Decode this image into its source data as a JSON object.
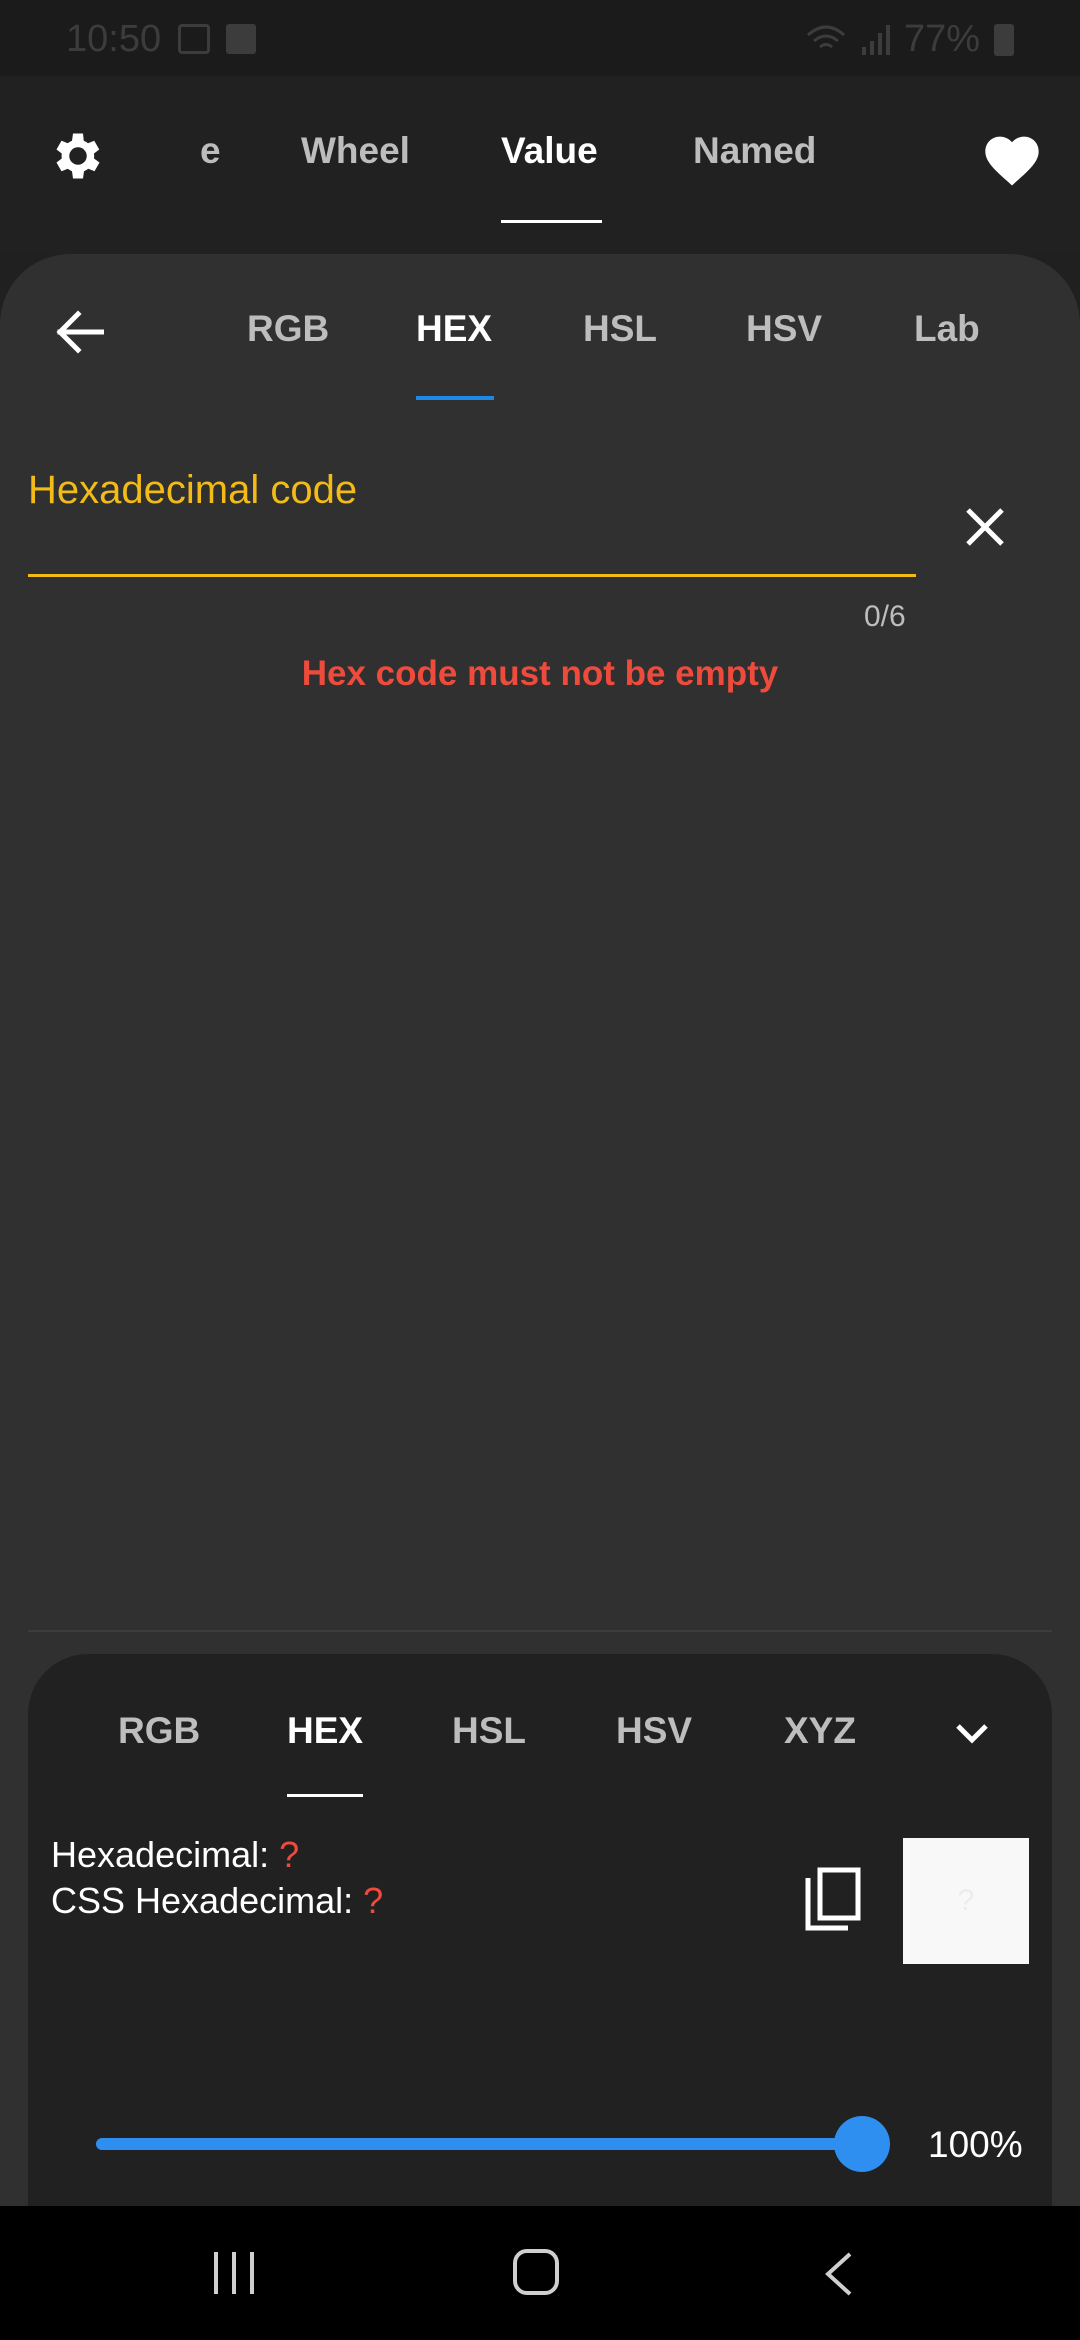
{
  "status_bar": {
    "time": "10:50",
    "battery": "77%"
  },
  "top_tabs": {
    "partial": "e",
    "wheel": "Wheel",
    "value": "Value",
    "named": "Named"
  },
  "sub_tabs": {
    "rgb": "RGB",
    "hex": "HEX",
    "hsl": "HSL",
    "hsv": "HSV",
    "lab": "Lab"
  },
  "hex_input": {
    "label": "Hexadecimal code",
    "value": "",
    "counter": "0/6",
    "error": "Hex code must not be empty"
  },
  "bottom_tabs": {
    "rgb": "RGB",
    "hex": "HEX",
    "hsl": "HSL",
    "hsv": "HSV",
    "xyz": "XYZ"
  },
  "info": {
    "hex_label": "Hexadecimal: ",
    "hex_value": "?",
    "css_label": "CSS Hexadecimal: ",
    "css_value": "?",
    "swatch_text": "?"
  },
  "slider": {
    "value_text": "100%",
    "level": 1.0
  },
  "colors": {
    "accent": "#f2bb17",
    "error": "#ef4b3c",
    "blue": "#1e88e5"
  }
}
